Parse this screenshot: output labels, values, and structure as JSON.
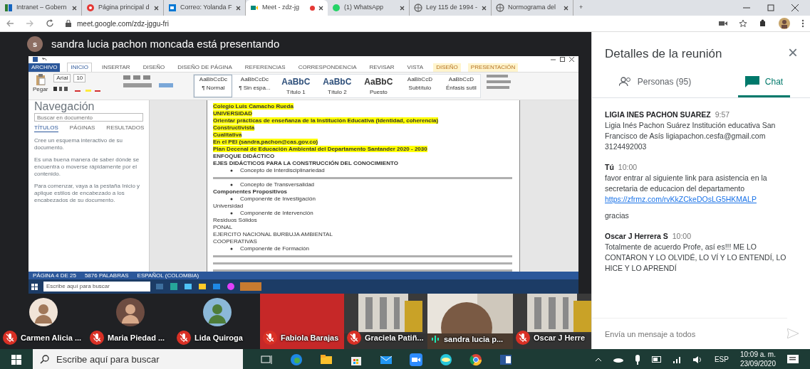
{
  "browser": {
    "tabs": [
      {
        "title": "Intranet – Gobern",
        "kind": "grid",
        "selected": false
      },
      {
        "title": "Página principal d",
        "kind": "red",
        "selected": false
      },
      {
        "title": "Correo: Yolanda F",
        "kind": "mail",
        "selected": false
      },
      {
        "title": "Meet - zdz-jg",
        "kind": "meet",
        "selected": true,
        "recording": true
      },
      {
        "title": "(1) WhatsApp",
        "kind": "chat",
        "selected": false
      },
      {
        "title": "Ley 115 de 1994 -",
        "kind": "globe",
        "selected": false
      },
      {
        "title": "Normograma del",
        "kind": "globe",
        "selected": false
      }
    ],
    "new_tab": "+",
    "address": "meet.google.com/zdz-jggu-fri"
  },
  "presenter": {
    "initial": "s",
    "text": "sandra lucia pachon moncada está presentando"
  },
  "shared_screen": {
    "ribbon_tabs": [
      {
        "label": "ARCHIVO",
        "kind": "file",
        "selected": false
      },
      {
        "label": "INICIO",
        "kind": "tab",
        "selected": true
      },
      {
        "label": "INSERTAR",
        "kind": "tab",
        "selected": false
      },
      {
        "label": "DISEÑO",
        "kind": "tab",
        "selected": false
      },
      {
        "label": "DISEÑO DE PÁGINA",
        "kind": "tab",
        "selected": false
      },
      {
        "label": "REFERENCIAS",
        "kind": "tab",
        "selected": false
      },
      {
        "label": "CORRESPONDENCIA",
        "kind": "tab",
        "selected": false
      },
      {
        "label": "REVISAR",
        "kind": "tab",
        "selected": false
      },
      {
        "label": "VISTA",
        "kind": "tab",
        "selected": false
      },
      {
        "label": "DISEÑO",
        "kind": "context",
        "selected": false
      },
      {
        "label": "PRESENTACIÓN",
        "kind": "context",
        "selected": false
      }
    ],
    "paste": "Pegar",
    "font": "Arial",
    "size": "10",
    "styles": [
      {
        "sample": "AaBbCcDc",
        "name": "¶ Normal",
        "selected": true
      },
      {
        "sample": "AaBbCcDc",
        "name": "¶ Sin espa...",
        "selected": false
      },
      {
        "sample": "AaBbC",
        "name": "Título 1",
        "selected": false
      },
      {
        "sample": "AaBbC",
        "name": "Título 2",
        "selected": false
      },
      {
        "sample": "AaBbC",
        "name": "Puesto",
        "selected": false
      },
      {
        "sample": "AaBbCcD",
        "name": "Subtítulo",
        "selected": false
      },
      {
        "sample": "AaBbCcD",
        "name": "Énfasis sutil",
        "selected": false
      }
    ],
    "nav_title": "Navegación",
    "nav_placeholder": "Buscar en documento",
    "nav_tabs": [
      {
        "label": "TÍTULOS",
        "selected": true
      },
      {
        "label": "PÁGINAS",
        "selected": false
      },
      {
        "label": "RESULTADOS",
        "selected": false
      }
    ],
    "nav_text": [
      "Cree un esquema interactivo de su documento.",
      "Es una buena manera de saber dónde se encuentra o moverse rápidamente por el contenido.",
      "Para comenzar, vaya a la pestaña Inicio y aplique estilos de encabezado a los encabezados de su documento."
    ],
    "doc_lines": [
      {
        "kind": "highlight",
        "text": "Colegio Luis Camacho Rueda"
      },
      {
        "kind": "highlight",
        "text": "UNIVERSIDAD"
      },
      {
        "kind": "highlight",
        "text": "Orientar prácticas de enseñanza de la Institución Educativa (Identidad, coherencia)"
      },
      {
        "kind": "highlight",
        "text": "Constructivista"
      },
      {
        "kind": "highlight",
        "text": "Cualitativa"
      },
      {
        "kind": "highlight",
        "text": "En el PEI (sandra.pachon@cas.gov.co)"
      },
      {
        "kind": "highlight",
        "text": "Plan Decenal de Educación Ambiental del Departamento Santander 2020 - 2030"
      },
      {
        "kind": "heading",
        "text": "ENFOQUE DIDÁCTICO"
      },
      {
        "kind": "heading",
        "text": "EJES DIDÁCTICOS PARA LA CONSTRUCCIÓN DEL CONOCIMIENTO"
      },
      {
        "kind": "bullet",
        "text": "Concepto de Interdisciplinariedad"
      },
      {
        "kind": "blur"
      },
      {
        "kind": "bullet",
        "text": "Concepto de Transversalidad"
      },
      {
        "kind": "heading",
        "text": "Componentes Propositivos"
      },
      {
        "kind": "bullet",
        "text": "Componente de Investigación"
      },
      {
        "kind": "plain",
        "text": "Universidad"
      },
      {
        "kind": "bullet",
        "text": "Componente de Intervención"
      },
      {
        "kind": "plain",
        "text": "Residuos Sólidos"
      },
      {
        "kind": "plain",
        "text": "PONAL"
      },
      {
        "kind": "plain",
        "text": "EJERCITO NACIONAL BURBUJA AMBIENTAL"
      },
      {
        "kind": "plain",
        "text": "COOPERATIVAS"
      },
      {
        "kind": "bullet",
        "text": "Componente de Formación"
      },
      {
        "kind": "blur"
      },
      {
        "kind": "blur"
      },
      {
        "kind": "blur"
      }
    ],
    "status": [
      "PÁGINA 4 DE 25",
      "5876 PALABRAS",
      "ESPAÑOL (COLOMBIA)"
    ],
    "taskbar_search": "Escribe aquí para buscar"
  },
  "participants": [
    {
      "name": "Carmen Alicia ...",
      "kind": "avatar",
      "muted": true,
      "speaking": false
    },
    {
      "name": "Maria Piedad ...",
      "kind": "avatar",
      "muted": true,
      "speaking": false
    },
    {
      "name": "Lida Quiroga",
      "kind": "avatar",
      "muted": true,
      "speaking": false
    },
    {
      "name": "Fabiola Barajas",
      "kind": "red",
      "muted": true,
      "speaking": false
    },
    {
      "name": "Graciela Patiñ...",
      "kind": "video",
      "muted": true,
      "speaking": false
    },
    {
      "name": "sandra lucia p...",
      "kind": "video",
      "muted": false,
      "speaking": true
    },
    {
      "name": "Oscar J Herre",
      "kind": "video",
      "muted": true,
      "speaking": false
    }
  ],
  "panel": {
    "title": "Detalles de la reunión",
    "close": "×",
    "tabs": [
      {
        "label": "Personas (95)",
        "kind": "people",
        "selected": false
      },
      {
        "label": "Chat",
        "kind": "chat",
        "selected": true
      }
    ],
    "messages": [
      {
        "sender": "LIGIA INES PACHON SUAREZ",
        "time": "9:57",
        "paragraphs": [
          {
            "text": "Ligia Inés Pachon Suárez Institución educativa San Francisco de Asís ligiapachon.cesfa@gmail.com 3124492003"
          }
        ]
      },
      {
        "sender": "Tú",
        "time": "10:00",
        "paragraphs": [
          {
            "text": "favor entrar al siguiente link para asistencia en la secretaria de educacion del departamento",
            "link": "https://zfrmz.com/rvKkZCkeDOsLG5HKMALP"
          },
          {
            "text": "gracias"
          }
        ]
      },
      {
        "sender": "Oscar J Herrera S",
        "time": "10:00",
        "paragraphs": [
          {
            "text": "Totalmente de acuerdo Profe, así es!!! ME LO CONTARON Y LO OLVIDÉ, LO VÍ Y LO ENTENDÍ, LO HICE Y LO APRENDÍ"
          }
        ]
      }
    ],
    "input_placeholder": "Envía un mensaje a todos"
  },
  "taskbar": {
    "search_placeholder": "Escribe aquí para buscar",
    "language": "ESP",
    "time": "10:09 a. m.",
    "date": "23/09/2020"
  }
}
